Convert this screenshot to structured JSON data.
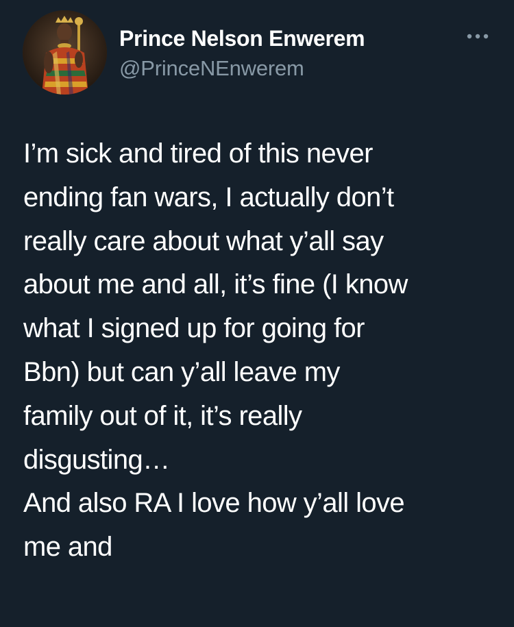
{
  "author": {
    "display_name": "Prince Nelson Enwerem",
    "handle": "@PrinceNEnwerem",
    "avatar_icon": "profile-photo"
  },
  "menu": {
    "icon": "more-options-icon"
  },
  "tweet": {
    "lines": [
      "I’m sick and tired of this never",
      "ending fan wars, I actually don’t",
      "really care about what y’all say",
      "about me and all, it’s fine (I know",
      "what I signed up for going for",
      "Bbn) but can y’all leave my",
      "family out of it, it’s really",
      "disgusting…",
      "And also RA I love how y’all love",
      "me and"
    ]
  },
  "colors": {
    "background": "#15202b",
    "text": "#ffffff",
    "secondary_text": "#8899a6"
  }
}
